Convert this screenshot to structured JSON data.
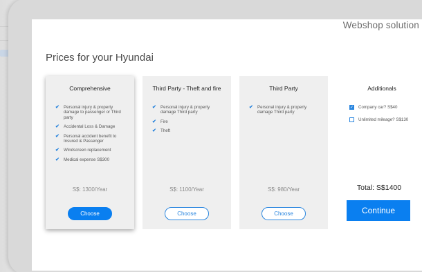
{
  "brand": "Webshop solution",
  "page_title": "Prices for your Hyundai",
  "plans": [
    {
      "title": "Comprehensive",
      "features": [
        "Personal injury & property damage to passenger or Third party",
        "Accidental Loss & Damage",
        "Personal accident benefit to Insured & Passenger",
        "Windscreen replacement",
        "Medical expense S$300"
      ],
      "price": "S$: 1300/Year",
      "choose_label": "Choose"
    },
    {
      "title": "Third Party - Theft and fire",
      "features": [
        "Personal injury & property damage Third party",
        "Fire",
        "Theft"
      ],
      "price": "S$: 1100/Year",
      "choose_label": "Choose"
    },
    {
      "title": "Third Party",
      "features": [
        "Personal injury & property damage Third party"
      ],
      "price": "S$: 980/Year",
      "choose_label": "Choose"
    }
  ],
  "additionals": {
    "title": "Additionals",
    "options": [
      {
        "label": "Company car? S$40",
        "checked": true
      },
      {
        "label": "Unlimited mileage? S$130",
        "checked": false
      }
    ],
    "total": "Total: S$1400",
    "continue_label": "Continue"
  },
  "colors": {
    "accent": "#0a7ff0",
    "card_bg": "#efefef"
  }
}
